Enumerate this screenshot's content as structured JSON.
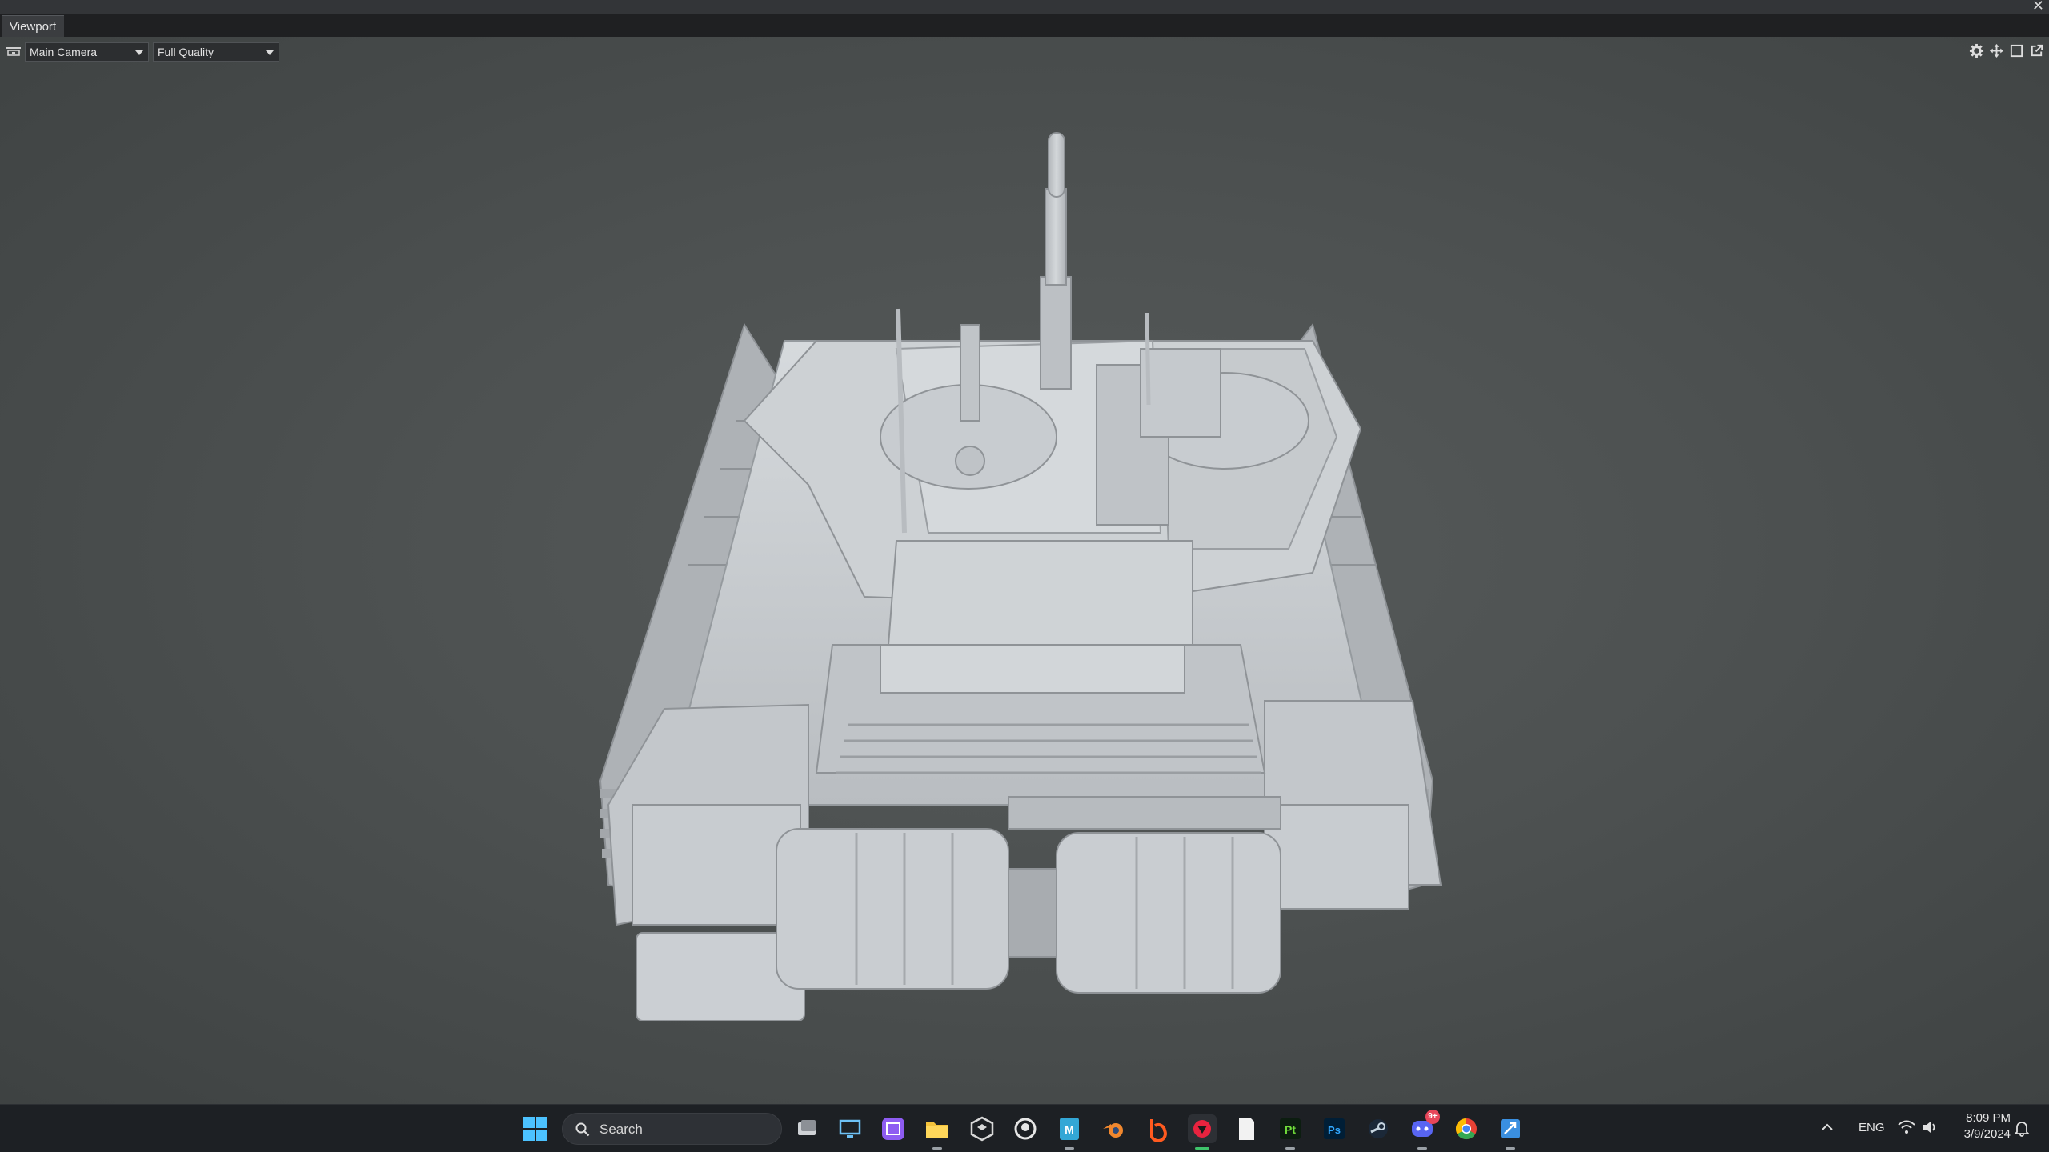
{
  "window": {
    "close_glyph": "✕"
  },
  "tab": {
    "label": "Viewport"
  },
  "toolbar": {
    "camera_icon": "camera-icon",
    "camera_select": "Main Camera",
    "quality_select": "Full Quality",
    "right_icons": [
      "settings-icon",
      "move-icon",
      "maximize-icon",
      "popout-icon"
    ]
  },
  "viewport": {
    "subject": "tank-3d-model",
    "background": "#4d5151",
    "model_color": "#c4c8cc"
  },
  "taskbar": {
    "search_placeholder": "Search",
    "apps": [
      {
        "name": "task-view",
        "active": false
      },
      {
        "name": "remote-desktop",
        "active": false
      },
      {
        "name": "purple-app",
        "active": false
      },
      {
        "name": "file-explorer",
        "active": false
      },
      {
        "name": "unity",
        "active": false
      },
      {
        "name": "github-desktop",
        "active": false
      },
      {
        "name": "marmoset",
        "active": true
      },
      {
        "name": "blender",
        "active": false
      },
      {
        "name": "orange-app",
        "active": false
      },
      {
        "name": "red-app",
        "active": true
      },
      {
        "name": "notepad",
        "active": false
      },
      {
        "name": "painter",
        "active": true
      },
      {
        "name": "photoshop",
        "active": false
      },
      {
        "name": "steam",
        "active": false
      },
      {
        "name": "discord",
        "active": true,
        "badge": "9+"
      },
      {
        "name": "chrome",
        "active": false
      },
      {
        "name": "blue-app",
        "active": true
      }
    ],
    "lang": "ENG",
    "time": "8:09 PM",
    "date": "3/9/2024"
  }
}
